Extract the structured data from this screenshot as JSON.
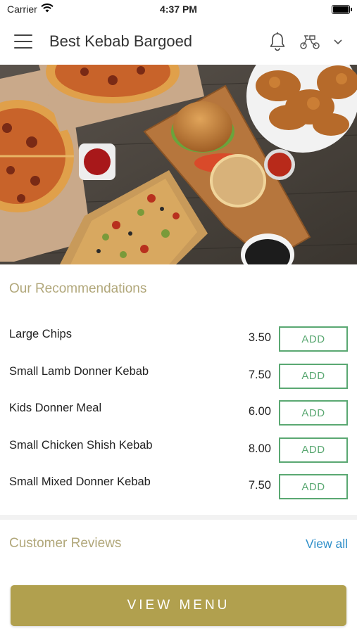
{
  "status_bar": {
    "carrier": "Carrier",
    "time": "4:37 PM",
    "icons": [
      "wifi-icon",
      "battery-icon"
    ]
  },
  "nav": {
    "title": "Best Kebab Bargoed",
    "icons": [
      "menu-icon",
      "bell-icon",
      "scooter-icon",
      "chevron-down-icon"
    ]
  },
  "hero": {
    "description_icon": "food-photo"
  },
  "recommendations": {
    "title": "Our Recommendations",
    "add_label": "ADD",
    "items": [
      {
        "name": "Large Chips",
        "price": "3.50"
      },
      {
        "name": "Small Lamb Donner Kebab",
        "price": "7.50"
      },
      {
        "name": "Kids Donner Meal",
        "price": "6.00"
      },
      {
        "name": "Small Chicken Shish Kebab",
        "price": "8.00"
      },
      {
        "name": "Small Mixed Donner Kebab",
        "price": "7.50"
      }
    ]
  },
  "reviews": {
    "title": "Customer Reviews",
    "view_all": "View all"
  },
  "footer": {
    "button_label": "VIEW MENU"
  },
  "colors": {
    "accent_gold": "#b1a04e",
    "section_title": "#b1a77a",
    "add_green": "#5aa872",
    "link_blue": "#2f8fc9"
  }
}
